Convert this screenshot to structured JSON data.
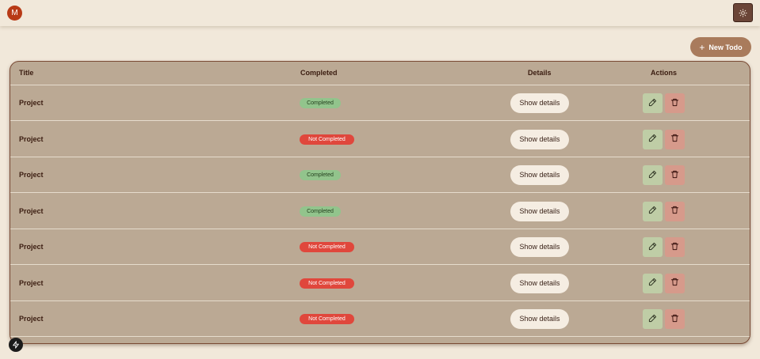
{
  "header": {
    "avatar_initial": "M"
  },
  "toolbar": {
    "new_todo_label": "New Todo"
  },
  "table": {
    "columns": {
      "title": "Title",
      "completed": "Completed",
      "details": "Details",
      "actions": "Actions"
    },
    "rows": [
      {
        "title": "Project",
        "status": "Completed",
        "completed": true,
        "details_label": "Show details"
      },
      {
        "title": "Project",
        "status": "Not Completed",
        "completed": false,
        "details_label": "Show details"
      },
      {
        "title": "Project",
        "status": "Completed",
        "completed": true,
        "details_label": "Show details"
      },
      {
        "title": "Project",
        "status": "Completed",
        "completed": true,
        "details_label": "Show details"
      },
      {
        "title": "Project",
        "status": "Not Completed",
        "completed": false,
        "details_label": "Show details"
      },
      {
        "title": "Project",
        "status": "Not Completed",
        "completed": false,
        "details_label": "Show details"
      },
      {
        "title": "Project",
        "status": "Not Completed",
        "completed": false,
        "details_label": "Show details"
      }
    ]
  },
  "colors": {
    "background": "#f1e8da",
    "table": "#bba994",
    "accent": "#a97b5c",
    "completed": "#92c48c",
    "not_completed": "#e0473c",
    "avatar": "#b83a16"
  },
  "icons": {
    "theme": "sun-icon",
    "new_todo": "plus-icon",
    "edit": "pencil-icon",
    "delete": "trash-icon",
    "dev_badge": "lightning-icon"
  }
}
